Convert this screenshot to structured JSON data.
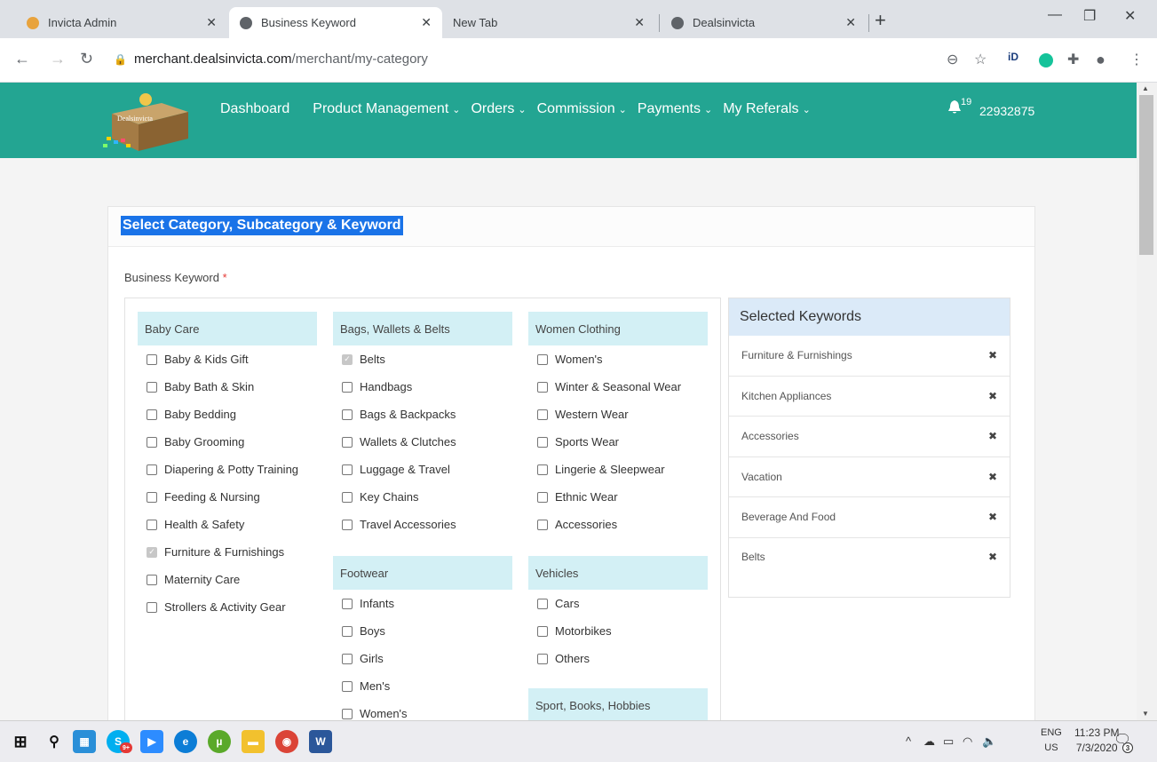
{
  "browser": {
    "tabs": [
      {
        "title": "Invicta Admin",
        "active": false
      },
      {
        "title": "Business Keyword",
        "active": true
      },
      {
        "title": "New Tab",
        "active": false
      },
      {
        "title": "Dealsinvicta",
        "active": false
      }
    ],
    "url_host": "merchant.dealsinvicta.com",
    "url_path": "/merchant/my-category"
  },
  "header": {
    "logo_text": "Dealsinvicta",
    "nav": [
      {
        "label": "Dashboard",
        "dropdown": false
      },
      {
        "label": "Product Management",
        "dropdown": true
      },
      {
        "label": "Orders",
        "dropdown": true
      },
      {
        "label": "Commission",
        "dropdown": true
      },
      {
        "label": "Payments",
        "dropdown": true
      },
      {
        "label": "My Referals",
        "dropdown": true
      }
    ],
    "notification_count": "19",
    "user_id": "22932875"
  },
  "page": {
    "title": "Select Category, Subcategory & Keyword",
    "field_label": "Business Keyword",
    "required_mark": "*"
  },
  "categories": {
    "baby_care": {
      "name": "Baby Care",
      "items": [
        {
          "label": "Baby & Kids Gift",
          "checked": false
        },
        {
          "label": "Baby Bath & Skin",
          "checked": false
        },
        {
          "label": "Baby Bedding",
          "checked": false
        },
        {
          "label": "Baby Grooming",
          "checked": false
        },
        {
          "label": "Diapering & Potty Training",
          "checked": false
        },
        {
          "label": "Feeding & Nursing",
          "checked": false
        },
        {
          "label": "Health & Safety",
          "checked": false
        },
        {
          "label": "Furniture & Furnishings",
          "checked": true
        },
        {
          "label": "Maternity Care",
          "checked": false
        },
        {
          "label": "Strollers & Activity Gear",
          "checked": false
        }
      ]
    },
    "bags": {
      "name": "Bags, Wallets & Belts",
      "items": [
        {
          "label": "Belts",
          "checked": true
        },
        {
          "label": "Handbags",
          "checked": false
        },
        {
          "label": "Bags & Backpacks",
          "checked": false
        },
        {
          "label": "Wallets & Clutches",
          "checked": false
        },
        {
          "label": "Luggage & Travel",
          "checked": false
        },
        {
          "label": "Key Chains",
          "checked": false
        },
        {
          "label": "Travel Accessories",
          "checked": false
        }
      ]
    },
    "footwear": {
      "name": "Footwear",
      "items": [
        {
          "label": "Infants",
          "checked": false
        },
        {
          "label": "Boys",
          "checked": false
        },
        {
          "label": "Girls",
          "checked": false
        },
        {
          "label": "Men's",
          "checked": false
        },
        {
          "label": "Women's",
          "checked": false
        }
      ]
    },
    "women_clothing": {
      "name": "Women Clothing",
      "items": [
        {
          "label": "Women's",
          "checked": false
        },
        {
          "label": "Winter & Seasonal Wear",
          "checked": false
        },
        {
          "label": "Western Wear",
          "checked": false
        },
        {
          "label": "Sports Wear",
          "checked": false
        },
        {
          "label": "Lingerie & Sleepwear",
          "checked": false
        },
        {
          "label": "Ethnic Wear",
          "checked": false
        },
        {
          "label": "Accessories",
          "checked": false
        }
      ]
    },
    "vehicles": {
      "name": "Vehicles",
      "items": [
        {
          "label": "Cars",
          "checked": false
        },
        {
          "label": "Motorbikes",
          "checked": false
        },
        {
          "label": "Others",
          "checked": false
        }
      ]
    },
    "sport": {
      "name": "Sport, Books, Hobbies",
      "items": []
    }
  },
  "selected": {
    "title": "Selected Keywords",
    "items": [
      "Furniture & Furnishings",
      "Kitchen Appliances",
      "Accessories",
      "Vacation",
      "Beverage And Food",
      "Belts"
    ]
  },
  "taskbar": {
    "lang_top": "ENG",
    "lang_bottom": "US",
    "time": "11:23 PM",
    "date": "7/3/2020",
    "notification_badge": "3",
    "skype_badge": "9+"
  },
  "colors": {
    "header_bg": "#23a592",
    "category_bg": "#d3f0f5",
    "selected_head_bg": "#dbeaf8",
    "title_highlight": "#1a73e8"
  }
}
